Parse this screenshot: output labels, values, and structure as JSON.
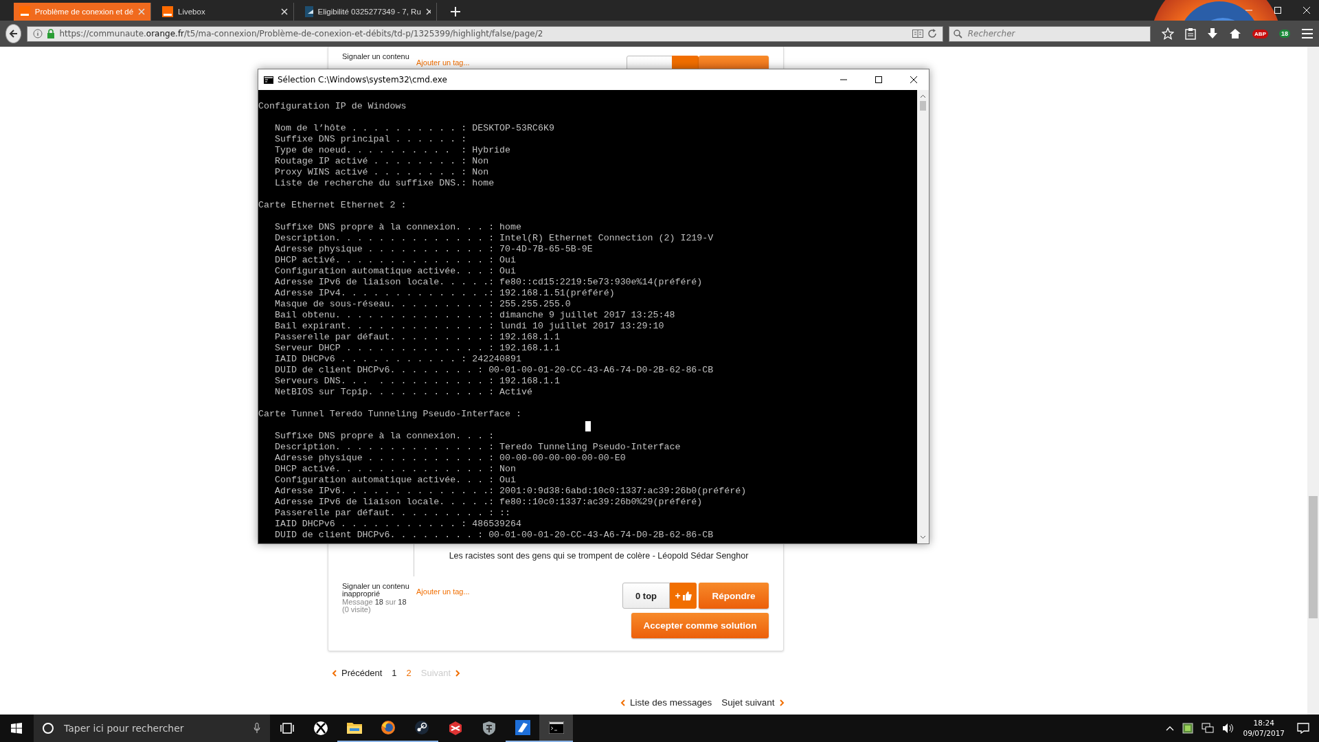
{
  "browser": {
    "tabs": [
      {
        "title": "Problème de conexion et dé",
        "selected": true,
        "kind": "orange"
      },
      {
        "title": "Livebox",
        "selected": false,
        "kind": "orange"
      },
      {
        "title": "Eligibilité 0325277349 - 7, Ru",
        "selected": false,
        "kind": "blue"
      }
    ],
    "url": "https://communaute.**orange.fr**/t5/ma-connexion/Problème-de-conexion-et-débits/td-p/1325399/highlight/false/page/2",
    "search": {
      "placeholder": "Rechercher"
    },
    "extension_label": "ABP",
    "badge": "18"
  },
  "post_top": {
    "report_link": "Signaler un contenu",
    "tag_link": "Ajouter un tag..."
  },
  "console_window": {
    "title": "Sélection C:\\Windows\\system32\\cmd.exe",
    "sections": [
      {
        "heading": "Configuration IP de Windows",
        "lines": [
          "Nom de l’hôte . . . . . . . . . . : DESKTOP-53RC6K9",
          "Suffixe DNS principal . . . . . . :",
          "Type de noeud. . . . . . . . . .  : Hybride",
          "Routage IP activé . . . . . . . . : Non",
          "Proxy WINS activé . . . . . . . . : Non",
          "Liste de recherche du suffixe DNS.: home"
        ]
      },
      {
        "heading": "Carte Ethernet Ethernet 2 :",
        "lines": [
          "Suffixe DNS propre à la connexion. . . : home",
          "Description. . . . . . . . . . . . . . : Intel(R) Ethernet Connection (2) I219-V",
          "Adresse physique . . . . . . . . . . . : 70-4D-7B-65-5B-9E",
          "DHCP activé. . . . . . . . . . . . . . : Oui",
          "Configuration automatique activée. . . : Oui",
          "Adresse IPv6 de liaison locale. . . . .: fe80::cd15:2219:5e73:930e%14(préféré)",
          "Adresse IPv4. . . . . . . . . . . . . .: 192.168.1.51(préféré)",
          "Masque de sous-réseau. . . . . . . . . : 255.255.255.0",
          "Bail obtenu. . . . . . . . . . . . . . : dimanche 9 juillet 2017 13:25:48",
          "Bail expirant. . . . . . . . . . . . . : lundi 10 juillet 2017 13:29:10",
          "Passerelle par défaut. . . . . . . . . : 192.168.1.1",
          "Serveur DHCP . . . . . . . . . . . . . : 192.168.1.1",
          "IAID DHCPv6 . . . . . . . . . . . : 242240891",
          "DUID de client DHCPv6. . . . . . . . : 00-01-00-01-20-CC-43-A6-74-D0-2B-62-86-CB",
          "Serveurs DNS. . .  . . . . . . . . . . : 192.168.1.1",
          "NetBIOS sur Tcpip. . . . . . . . . . . : Activé"
        ]
      },
      {
        "heading": "Carte Tunnel Teredo Tunneling Pseudo-Interface :",
        "lines": [
          "Suffixe DNS propre à la connexion. . . :",
          "Description. . . . . . . . . . . . . . : Teredo Tunneling Pseudo-Interface",
          "Adresse physique . . . . . . . . . . . : 00-00-00-00-00-00-00-E0",
          "DHCP activé. . . . . . . . . . . . . . : Non",
          "Configuration automatique activée. . . : Oui",
          "Adresse IPv6. . . . . . . . . . . . . .: 2001:0:9d38:6abd:10c0:1337:ac39:26b0(préféré)",
          "Adresse IPv6 de liaison locale. . . . .: fe80::10c0:1337:ac39:26b0%29(préféré)",
          "Passerelle par défaut. . . . . . . . . : ::",
          "IAID DHCPv6 . . . . . . . . . . . : 486539264",
          "DUID de client DHCPv6. . . . . . . . : 00-01-00-01-20-CC-43-A6-74-D0-2B-62-86-CB"
        ]
      }
    ]
  },
  "post": {
    "signature": "Les racistes sont des gens qui se trompent de colère - Léopold Sédar Senghor",
    "report_link": "Signaler un contenu inapproprié",
    "message_count": "Message **18** sur **18**",
    "visits": "(0 visite)",
    "tag_link": "Ajouter un tag...",
    "kudos": "0 top",
    "kudos_plus": "+",
    "reply": "Répondre",
    "accept": "Accepter comme solution"
  },
  "pagination": {
    "previous": "Précédent",
    "pages": [
      {
        "label": "1",
        "selected": false
      },
      {
        "label": "2",
        "selected": true
      }
    ],
    "next": "Suivant",
    "next_disabled": true
  },
  "bottom_nav": {
    "list": "Liste des messages",
    "next_topic": "Sujet suivant"
  },
  "taskbar": {
    "search_placeholder": "Taper ici pour rechercher",
    "apps": [
      {
        "kind": "task-view",
        "running": false,
        "selected": false
      },
      {
        "kind": "sphere",
        "running": false,
        "selected": false
      },
      {
        "kind": "folder",
        "running": true,
        "selected": false
      },
      {
        "kind": "browser",
        "running": true,
        "selected": false
      },
      {
        "kind": "gear",
        "running": true,
        "selected": false
      },
      {
        "kind": "game",
        "running": false,
        "selected": false
      },
      {
        "kind": "shield",
        "running": false,
        "selected": false
      },
      {
        "kind": "app",
        "running": true,
        "selected": false
      },
      {
        "kind": "console",
        "running": true,
        "selected": true
      }
    ],
    "time": "18:24",
    "date": "09/07/2017"
  }
}
